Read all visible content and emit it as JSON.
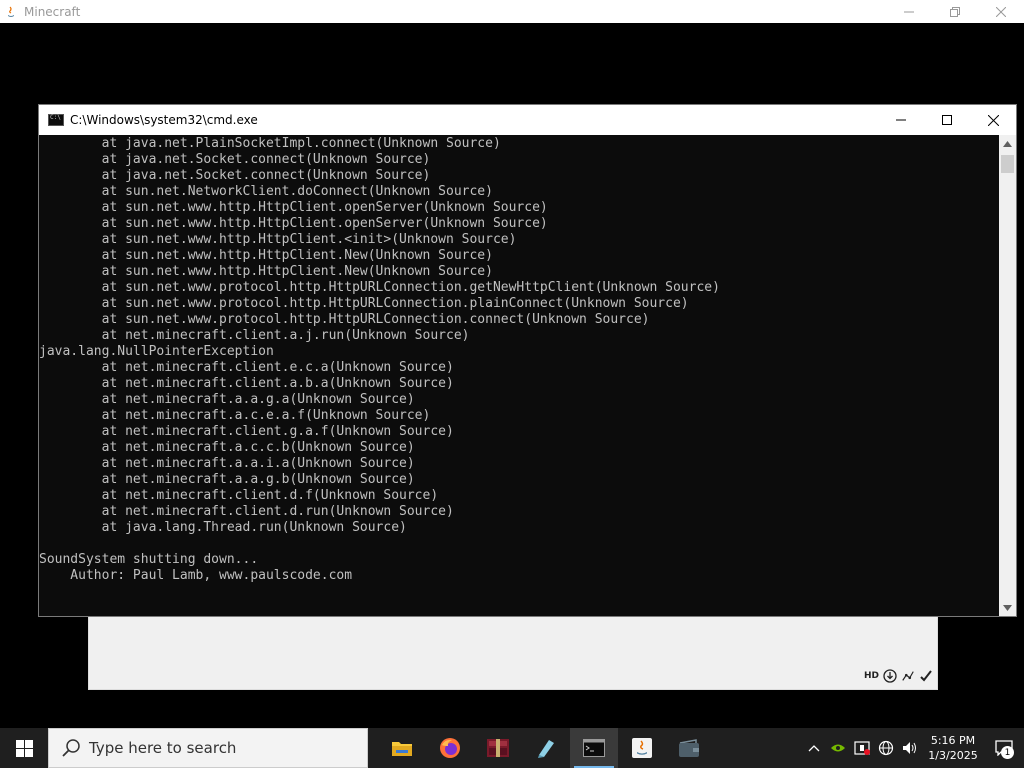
{
  "minecraft_window": {
    "title": "Minecraft",
    "tray_icons": [
      {
        "icon": "hd-icon",
        "label": "HD"
      },
      {
        "icon": "globe-download-icon"
      },
      {
        "icon": "network-status-icon"
      },
      {
        "icon": "checkmark-icon"
      }
    ]
  },
  "cmd_window": {
    "title": "C:\\Windows\\system32\\cmd.exe",
    "lines": [
      "        at java.net.PlainSocketImpl.connect(Unknown Source)",
      "        at java.net.Socket.connect(Unknown Source)",
      "        at java.net.Socket.connect(Unknown Source)",
      "        at sun.net.NetworkClient.doConnect(Unknown Source)",
      "        at sun.net.www.http.HttpClient.openServer(Unknown Source)",
      "        at sun.net.www.http.HttpClient.openServer(Unknown Source)",
      "        at sun.net.www.http.HttpClient.<init>(Unknown Source)",
      "        at sun.net.www.http.HttpClient.New(Unknown Source)",
      "        at sun.net.www.http.HttpClient.New(Unknown Source)",
      "        at sun.net.www.protocol.http.HttpURLConnection.getNewHttpClient(Unknown Source)",
      "        at sun.net.www.protocol.http.HttpURLConnection.plainConnect(Unknown Source)",
      "        at sun.net.www.protocol.http.HttpURLConnection.connect(Unknown Source)",
      "        at net.minecraft.client.a.j.run(Unknown Source)",
      "java.lang.NullPointerException",
      "        at net.minecraft.client.e.c.a(Unknown Source)",
      "        at net.minecraft.client.a.b.a(Unknown Source)",
      "        at net.minecraft.a.a.g.a(Unknown Source)",
      "        at net.minecraft.a.c.e.a.f(Unknown Source)",
      "        at net.minecraft.client.g.a.f(Unknown Source)",
      "        at net.minecraft.a.c.c.b(Unknown Source)",
      "        at net.minecraft.a.a.i.a(Unknown Source)",
      "        at net.minecraft.a.a.g.b(Unknown Source)",
      "        at net.minecraft.client.d.f(Unknown Source)",
      "        at net.minecraft.client.d.run(Unknown Source)",
      "        at java.lang.Thread.run(Unknown Source)",
      "",
      "SoundSystem shutting down...",
      "    Author: Paul Lamb, www.paulscode.com"
    ]
  },
  "taskbar": {
    "search_placeholder": "Type here to search",
    "pinned": [
      {
        "name": "file-explorer",
        "icon": "folder-icon",
        "active": false
      },
      {
        "name": "firefox",
        "icon": "firefox-icon",
        "active": false
      },
      {
        "name": "winrar",
        "icon": "winrar-icon",
        "active": false
      },
      {
        "name": "notepad",
        "icon": "notepad-icon",
        "active": false
      },
      {
        "name": "cmd",
        "icon": "terminal-icon",
        "active": true
      },
      {
        "name": "java",
        "icon": "java-icon",
        "active": false
      },
      {
        "name": "wallet",
        "icon": "wallet-icon",
        "active": false
      }
    ],
    "clock_time": "5:16 PM",
    "clock_date": "1/3/2025",
    "notification_count": "1"
  },
  "colors": {
    "taskbar_bg": "#1f1f1f",
    "console_bg": "#0c0c0c",
    "console_text": "#c0c0c0",
    "active_accent": "#76b9ed"
  }
}
